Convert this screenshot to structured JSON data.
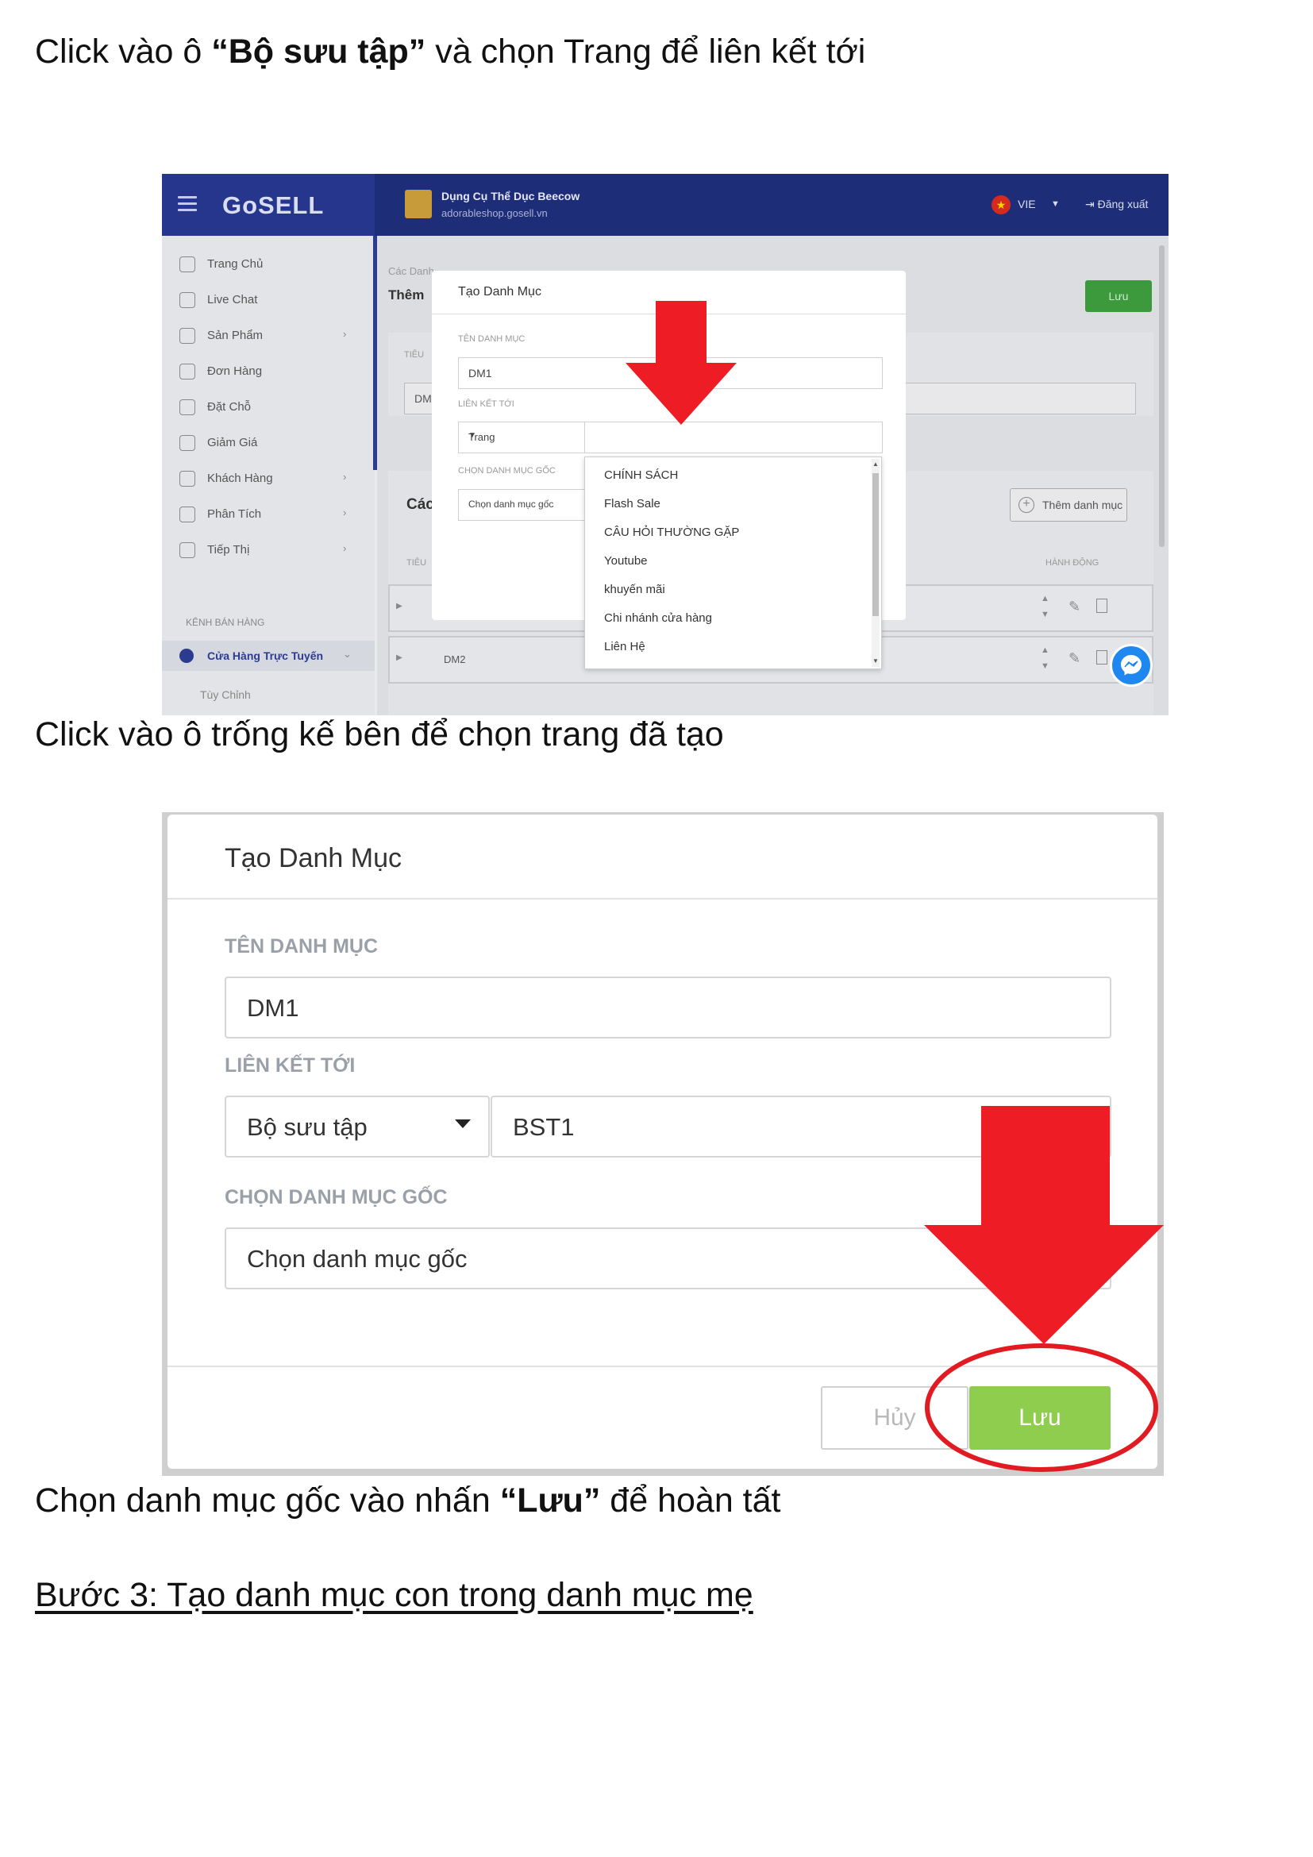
{
  "doc": {
    "p1": {
      "before": "Click vào ô ",
      "bold": "“Bộ sưu tập”",
      "after": " và chọn Trang để liên kết tới"
    },
    "p2": "Click vào ô trống kế bên để chọn trang đã tạo",
    "p3": {
      "before": "Chọn danh mục gốc vào nhấn ",
      "bold": "“Lưu”",
      "after": " để hoàn tất"
    },
    "step3": "Bước 3: Tạo danh mục con trong danh mục mẹ"
  },
  "shot1": {
    "logo": "GoSELL",
    "store_name": "Dụng Cụ Thể Dục Beecow",
    "store_url": "adorableshop.gosell.vn",
    "lang": "VIE",
    "logout": "Đăng xuất",
    "menu": [
      "Trang Chủ",
      "Live Chat",
      "Sản Phẩm",
      "Đơn Hàng",
      "Đặt Chỗ",
      "Giảm Giá",
      "Khách Hàng",
      "Phân Tích",
      "Tiếp Thị"
    ],
    "channel_label": "KÊNH BÁN HÀNG",
    "active_channel": "Cửa Hàng Trực Tuyến",
    "customize": "Tùy Chỉnh",
    "breadcrumb": "Các Danh",
    "page_title": "Thêm",
    "save": "Lưu",
    "field_label": "TIÊU",
    "field_value": "DM",
    "section_title": "Các",
    "add_category": "Thêm danh mục",
    "col_title": "TIÊU",
    "col_action": "HÀNH ĐỘNG",
    "row2_name": "DM2",
    "modal": {
      "title": "Tạo Danh Mục",
      "name_label": "TÊN DANH MỤC",
      "name_value": "DM1",
      "link_label": "LIÊN KẾT TỚI",
      "link_type": "Trang",
      "root_label": "CHỌN DANH MỤC GỐC",
      "root_placeholder": "Chọn danh mục gốc",
      "options": [
        "CHÍNH SÁCH",
        "Flash Sale",
        "CÂU HỎI THƯỜNG GẶP",
        "Youtube",
        "khuyến mãi",
        "Chi nhánh cửa hàng",
        "Liên Hệ"
      ]
    }
  },
  "shot2": {
    "title": "Tạo Danh Mục",
    "name_label": "TÊN DANH MỤC",
    "name_value": "DM1",
    "link_label": "LIÊN KẾT TỚI",
    "link_type": "Bộ sưu tập",
    "link_value": "BST1",
    "root_label": "CHỌN DANH MỤC GỐC",
    "root_placeholder": "Chọn danh mục gốc",
    "cancel": "Hủy",
    "save": "Lưu"
  },
  "colors": {
    "arrow_red": "#ee1c25",
    "save_green": "#8fcd4f",
    "topbar_navy": "#1e2d78"
  }
}
